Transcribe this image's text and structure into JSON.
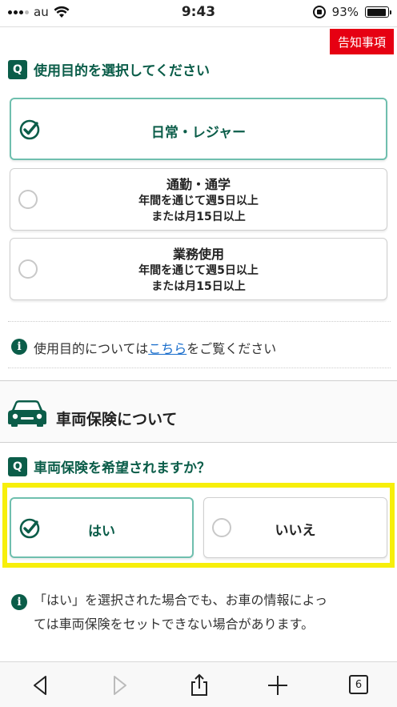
{
  "status_bar": {
    "carrier": "au",
    "time": "9:43",
    "battery": "93%",
    "battery_level": 0.93
  },
  "notice_button": "告知事項",
  "purpose_question": {
    "badge": "Q",
    "title": "使用目的を選択してください",
    "options": [
      {
        "label": "日常・レジャー",
        "selected": true
      },
      {
        "label": "通勤・通学",
        "line2": "年間を通じて週5日以上",
        "line3": "または月15日以上",
        "selected": false
      },
      {
        "label": "業務使用",
        "line2": "年間を通じて週5日以上",
        "line3": "または月15日以上",
        "selected": false
      }
    ],
    "info_icon": "info-icon",
    "info_prefix": "使用目的については",
    "info_link": "こちら",
    "info_suffix": "をご覧ください"
  },
  "vehicle_section": {
    "icon": "car-icon",
    "title": "車両保険について"
  },
  "vehicle_question": {
    "badge": "Q",
    "title": "車両保険を希望されますか？",
    "options": [
      {
        "label": "はい",
        "selected": true
      },
      {
        "label": "いいえ",
        "selected": false
      }
    ],
    "info_line1": "「はい」を選択された場合でも、お車の情報によっ",
    "info_line2": "ては車両保険をセットできない場合があります。"
  },
  "bottom_toolbar": {
    "tabs_count": "6"
  },
  "colors": {
    "brand_green": "#0b5d49",
    "selected_border": "#6fbfae",
    "notice_red": "#e60012",
    "highlight_yellow": "#f7ef0b"
  }
}
